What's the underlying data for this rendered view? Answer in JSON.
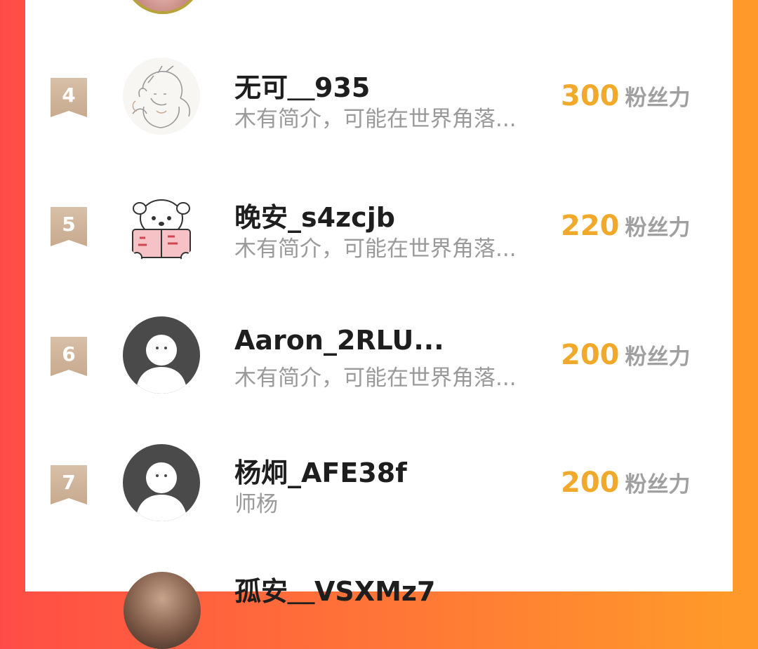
{
  "colors": {
    "accent_orange": "#f0a92a",
    "rank_badge": "#c8aa8e",
    "text_primary": "#1e1e1e",
    "text_secondary": "#9a9a9a"
  },
  "list": {
    "items": [
      {
        "rank": "4",
        "name": "无可＿935",
        "bio": "木有简介，可能在世界角落...",
        "fans": "300",
        "fans_unit": "粉丝力",
        "avatar": "sketch-avatar"
      },
      {
        "rank": "5",
        "name": "晚安_s4zcjb",
        "bio": "木有简介，可能在世界角落...",
        "fans": "220",
        "fans_unit": "粉丝力",
        "avatar": "bear-avatar"
      },
      {
        "rank": "6",
        "name": "Aaron_2RLU...",
        "bio": "木有简介，可能在世界角落...",
        "fans": "200",
        "fans_unit": "粉丝力",
        "avatar": "default-avatar"
      },
      {
        "rank": "7",
        "name": "杨炯_AFE38f",
        "bio": "师杨",
        "fans": "200",
        "fans_unit": "粉丝力",
        "avatar": "default-avatar"
      }
    ],
    "partial_bottom_name": "孤安＿VSXMz7"
  }
}
